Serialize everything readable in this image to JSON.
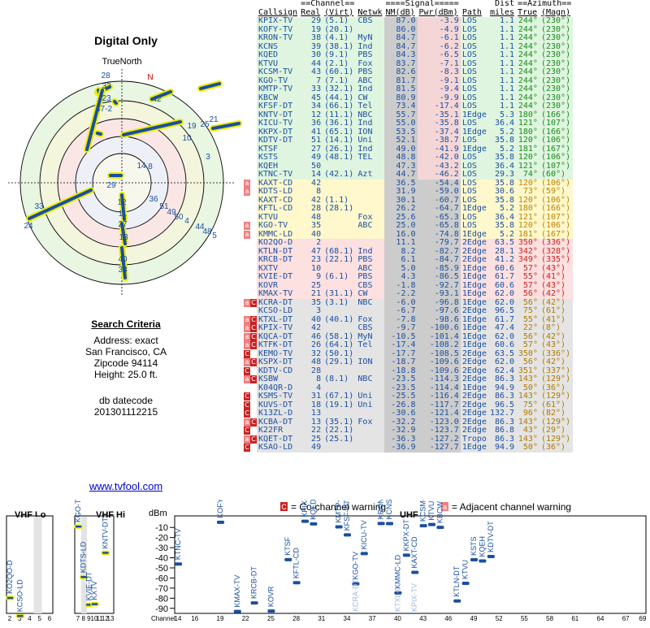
{
  "title": "Digital Only",
  "polar": {
    "north_label": "TrueNorth",
    "n_label": "N"
  },
  "criteria": {
    "heading": "Search Criteria",
    "address": "Address: exact",
    "city": "San Francisco, CA",
    "zip": "Zipcode 94114",
    "height": "Height: 25.0 ft.",
    "db_label": "db datecode",
    "db_value": "201301112215"
  },
  "link": "www.tvfool.com",
  "table_headers": {
    "group1": "==Channel==",
    "group2": "====Signal=====",
    "group3": "Dist",
    "group4": "==Azimuth==",
    "callsign": "Callsign",
    "real": "Real",
    "virt": "(Virt)",
    "netwk": "Netwk",
    "nm": "NM(dB)",
    "pwr": "Pwr(dBm)",
    "path": "Path",
    "miles": "miles",
    "true": "True",
    "magn": "(Magn)"
  },
  "colors": {
    "green": "#dff5df",
    "yellow": "#fff8cc",
    "red": "#fde0e0",
    "gray": "#e4e4e4",
    "accent_blue": "#1a4fa0"
  },
  "stations": [
    {
      "cs": "KPIX-TV",
      "real": "29",
      "virt": "(5.1)",
      "net": "CBS",
      "nm": "87.0",
      "pwr": "-3.9",
      "path": "LOS",
      "dist": "1.1",
      "t": "244°",
      "m": "(230°)",
      "band": "green",
      "warn": ""
    },
    {
      "cs": "KOFY-TV",
      "real": "19",
      "virt": "(20.1)",
      "net": "",
      "nm": "86.0",
      "pwr": "-4.9",
      "path": "LOS",
      "dist": "1.1",
      "t": "244°",
      "m": "(230°)",
      "band": "green",
      "warn": ""
    },
    {
      "cs": "KRON-TV",
      "real": "38",
      "virt": "(4.1)",
      "net": "MyN",
      "nm": "84.7",
      "pwr": "-6.1",
      "path": "LOS",
      "dist": "1.1",
      "t": "244°",
      "m": "(230°)",
      "band": "green",
      "warn": ""
    },
    {
      "cs": "KCNS",
      "real": "39",
      "virt": "(38.1)",
      "net": "Ind",
      "nm": "84.7",
      "pwr": "-6.2",
      "path": "LOS",
      "dist": "1.1",
      "t": "244°",
      "m": "(230°)",
      "band": "green",
      "warn": ""
    },
    {
      "cs": "KQED",
      "real": "30",
      "virt": "(9.1)",
      "net": "PBS",
      "nm": "84.3",
      "pwr": "-6.5",
      "path": "LOS",
      "dist": "1.1",
      "t": "244°",
      "m": "(230°)",
      "band": "green",
      "warn": ""
    },
    {
      "cs": "KTVU",
      "real": "44",
      "virt": "(2.1)",
      "net": "Fox",
      "nm": "83.7",
      "pwr": "-7.1",
      "path": "LOS",
      "dist": "1.1",
      "t": "244°",
      "m": "(230°)",
      "band": "green",
      "warn": ""
    },
    {
      "cs": "KCSM-TV",
      "real": "43",
      "virt": "(60.1)",
      "net": "PBS",
      "nm": "82.6",
      "pwr": "-8.3",
      "path": "LOS",
      "dist": "1.1",
      "t": "244°",
      "m": "(230°)",
      "band": "green",
      "warn": ""
    },
    {
      "cs": "KGO-TV",
      "real": "7",
      "virt": "(7.1)",
      "net": "ABC",
      "nm": "81.7",
      "pwr": "-9.1",
      "path": "LOS",
      "dist": "1.1",
      "t": "244°",
      "m": "(230°)",
      "band": "green",
      "warn": ""
    },
    {
      "cs": "KMTP-TV",
      "real": "33",
      "virt": "(32.1)",
      "net": "Ind",
      "nm": "81.5",
      "pwr": "-9.4",
      "path": "LOS",
      "dist": "1.1",
      "t": "244°",
      "m": "(230°)",
      "band": "green",
      "warn": ""
    },
    {
      "cs": "KBCW",
      "real": "45",
      "virt": "(44.1)",
      "net": "CW",
      "nm": "80.9",
      "pwr": "-9.9",
      "path": "LOS",
      "dist": "1.1",
      "t": "244°",
      "m": "(230°)",
      "band": "green",
      "warn": ""
    },
    {
      "cs": "KFSF-DT",
      "real": "34",
      "virt": "(66.1)",
      "net": "Tel",
      "nm": "73.4",
      "pwr": "-17.4",
      "path": "LOS",
      "dist": "1.1",
      "t": "244°",
      "m": "(230°)",
      "band": "green",
      "warn": ""
    },
    {
      "cs": "KNTV-DT",
      "real": "12",
      "virt": "(11.1)",
      "net": "NBC",
      "nm": "55.7",
      "pwr": "-35.1",
      "path": "1Edge",
      "dist": "5.3",
      "t": "180°",
      "m": "(166°)",
      "band": "green",
      "warn": ""
    },
    {
      "cs": "KICU-TV",
      "real": "36",
      "virt": "(36.1)",
      "net": "Ind",
      "nm": "55.0",
      "pwr": "-35.8",
      "path": "LOS",
      "dist": "36.4",
      "t": "121°",
      "m": "(107°)",
      "band": "green",
      "warn": ""
    },
    {
      "cs": "KKPX-DT",
      "real": "41",
      "virt": "(65.1)",
      "net": "ION",
      "nm": "53.5",
      "pwr": "-37.4",
      "path": "1Edge",
      "dist": "5.2",
      "t": "180°",
      "m": "(166°)",
      "band": "green",
      "warn": ""
    },
    {
      "cs": "KDTV-DT",
      "real": "51",
      "virt": "(14.1)",
      "net": "Uni",
      "nm": "52.1",
      "pwr": "-38.7",
      "path": "LOS",
      "dist": "35.8",
      "t": "120°",
      "m": "(106°)",
      "band": "green",
      "warn": ""
    },
    {
      "cs": "KTSF",
      "real": "27",
      "virt": "(26.1)",
      "net": "Ind",
      "nm": "49.0",
      "pwr": "-41.9",
      "path": "1Edge",
      "dist": "5.2",
      "t": "181°",
      "m": "(167°)",
      "band": "green",
      "warn": ""
    },
    {
      "cs": "KSTS",
      "real": "49",
      "virt": "(48.1)",
      "net": "TEL",
      "nm": "48.8",
      "pwr": "-42.0",
      "path": "LOS",
      "dist": "35.8",
      "t": "120°",
      "m": "(106°)",
      "band": "green",
      "warn": ""
    },
    {
      "cs": "KQEH",
      "real": "50",
      "virt": "",
      "net": "",
      "nm": "47.3",
      "pwr": "-43.2",
      "path": "LOS",
      "dist": "36.4",
      "t": "121°",
      "m": "(107°)",
      "band": "green",
      "warn": ""
    },
    {
      "cs": "KTNC-TV",
      "real": "14",
      "virt": "(42.1)",
      "net": "Azt",
      "nm": "44.7",
      "pwr": "-46.2",
      "path": "LOS",
      "dist": "29.3",
      "t": "74°",
      "m": "(60°)",
      "band": "green",
      "warn": ""
    },
    {
      "cs": "KAXT-CD",
      "real": "42",
      "virt": "",
      "net": "",
      "nm": "36.5",
      "pwr": "-54.4",
      "path": "LOS",
      "dist": "35.8",
      "t": "120°",
      "m": "(106°)",
      "band": "yellow",
      "warn": "a"
    },
    {
      "cs": "KDTS-LD",
      "real": "8",
      "virt": "",
      "net": "",
      "nm": "31.9",
      "pwr": "-59.0",
      "path": "LOS",
      "dist": "30.6",
      "t": "73°",
      "m": "(59°)",
      "band": "yellow",
      "warn": "a"
    },
    {
      "cs": "KAXT-CD",
      "real": "42",
      "virt": "(1.1)",
      "net": "",
      "nm": "30.1",
      "pwr": "-60.7",
      "path": "LOS",
      "dist": "35.8",
      "t": "120°",
      "m": "(106°)",
      "band": "yellow",
      "warn": ""
    },
    {
      "cs": "KFTL-CD",
      "real": "28",
      "virt": "(28.1)",
      "net": "",
      "nm": "26.2",
      "pwr": "-64.7",
      "path": "1Edge",
      "dist": "5.2",
      "t": "180°",
      "m": "(166°)",
      "band": "yellow",
      "warn": ""
    },
    {
      "cs": "KTVU",
      "real": "48",
      "virt": "",
      "net": "Fox",
      "nm": "25.6",
      "pwr": "-65.3",
      "path": "LOS",
      "dist": "36.4",
      "t": "121°",
      "m": "(107°)",
      "band": "yellow",
      "warn": ""
    },
    {
      "cs": "KGO-TV",
      "real": "35",
      "virt": "",
      "net": "ABC",
      "nm": "25.0",
      "pwr": "-65.8",
      "path": "LOS",
      "dist": "35.8",
      "t": "120°",
      "m": "(106°)",
      "band": "yellow",
      "warn": "a"
    },
    {
      "cs": "KMMC-LD",
      "real": "40",
      "virt": "",
      "net": "",
      "nm": "16.0",
      "pwr": "-74.8",
      "path": "1Edge",
      "dist": "5.2",
      "t": "181°",
      "m": "(167°)",
      "band": "yellow",
      "warn": "a"
    },
    {
      "cs": "KO2QO-D",
      "real": "2",
      "virt": "",
      "net": "",
      "nm": "11.1",
      "pwr": "-79.7",
      "path": "2Edge",
      "dist": "63.5",
      "t": "350°",
      "m": "(336°)",
      "band": "red",
      "warn": ""
    },
    {
      "cs": "KTLN-DT",
      "real": "47",
      "virt": "(68.1)",
      "net": "Ind",
      "nm": "8.2",
      "pwr": "-82.7",
      "path": "2Edge",
      "dist": "28.1",
      "t": "342°",
      "m": "(328°)",
      "band": "red",
      "warn": ""
    },
    {
      "cs": "KRCB-DT",
      "real": "23",
      "virt": "(22.1)",
      "net": "PBS",
      "nm": "6.1",
      "pwr": "-84.7",
      "path": "2Edge",
      "dist": "41.2",
      "t": "349°",
      "m": "(335°)",
      "band": "red",
      "warn": ""
    },
    {
      "cs": "KXTV",
      "real": "10",
      "virt": "",
      "net": "ABC",
      "nm": "5.0",
      "pwr": "-85.9",
      "path": "1Edge",
      "dist": "60.6",
      "t": "57°",
      "m": "(43°)",
      "band": "red",
      "warn": ""
    },
    {
      "cs": "KVIE-DT",
      "real": "9",
      "virt": "(6.1)",
      "net": "PBS",
      "nm": "4.3",
      "pwr": "-86.5",
      "path": "1Edge",
      "dist": "61.7",
      "t": "55°",
      "m": "(41°)",
      "band": "red",
      "warn": ""
    },
    {
      "cs": "KOVR",
      "real": "25",
      "virt": "",
      "net": "CBS",
      "nm": "-1.8",
      "pwr": "-92.7",
      "path": "1Edge",
      "dist": "60.6",
      "t": "57°",
      "m": "(43°)",
      "band": "red",
      "warn": ""
    },
    {
      "cs": "KMAX-TV",
      "real": "21",
      "virt": "(31.1)",
      "net": "CW",
      "nm": "-2.2",
      "pwr": "-93.1",
      "path": "1Edge",
      "dist": "62.0",
      "t": "56°",
      "m": "(42°)",
      "band": "red",
      "warn": ""
    },
    {
      "cs": "KCRA-DT",
      "real": "35",
      "virt": "(3.1)",
      "net": "NBC",
      "nm": "-6.0",
      "pwr": "-96.8",
      "path": "1Edge",
      "dist": "62.0",
      "t": "56°",
      "m": "(42°)",
      "band": "gray",
      "warn": "ac"
    },
    {
      "cs": "KCSO-LD",
      "real": "3",
      "virt": "",
      "net": "",
      "nm": "-6.7",
      "pwr": "-97.6",
      "path": "2Edge",
      "dist": "96.5",
      "t": "75°",
      "m": "(61°)",
      "band": "gray",
      "warn": ""
    },
    {
      "cs": "KTXL-DT",
      "real": "40",
      "virt": "(40.1)",
      "net": "Fox",
      "nm": "-7.8",
      "pwr": "-98.6",
      "path": "1Edge",
      "dist": "61.7",
      "t": "55°",
      "m": "(41°)",
      "band": "gray",
      "warn": "ac"
    },
    {
      "cs": "KPIX-TV",
      "real": "42",
      "virt": "",
      "net": "CBS",
      "nm": "-9.7",
      "pwr": "-100.6",
      "path": "1Edge",
      "dist": "47.4",
      "t": "22°",
      "m": "(8°)",
      "band": "gray",
      "warn": "ac"
    },
    {
      "cs": "KQCA-DT",
      "real": "46",
      "virt": "(58.1)",
      "net": "MyN",
      "nm": "-10.5",
      "pwr": "-101.4",
      "path": "1Edge",
      "dist": "62.0",
      "t": "56°",
      "m": "(42°)",
      "band": "gray",
      "warn": "ac"
    },
    {
      "cs": "KTFK-DT",
      "real": "26",
      "virt": "(64.1)",
      "net": "Tel",
      "nm": "-17.4",
      "pwr": "-108.2",
      "path": "1Edge",
      "dist": "60.6",
      "t": "57°",
      "m": "(43°)",
      "band": "gray",
      "warn": "ac"
    },
    {
      "cs": "KEMO-TV",
      "real": "32",
      "virt": "(50.1)",
      "net": "",
      "nm": "-17.7",
      "pwr": "-108.5",
      "path": "2Edge",
      "dist": "63.5",
      "t": "350°",
      "m": "(336°)",
      "band": "gray",
      "warn": "c"
    },
    {
      "cs": "KSPX-DT",
      "real": "48",
      "virt": "(29.1)",
      "net": "ION",
      "nm": "-18.7",
      "pwr": "-109.6",
      "path": "2Edge",
      "dist": "62.0",
      "t": "56°",
      "m": "(42°)",
      "band": "gray",
      "warn": "ac"
    },
    {
      "cs": "KDTV-CD",
      "real": "28",
      "virt": "",
      "net": "",
      "nm": "-18.8",
      "pwr": "-109.6",
      "path": "2Edge",
      "dist": "62.4",
      "t": "351°",
      "m": "(337°)",
      "band": "gray",
      "warn": "c"
    },
    {
      "cs": "KSBW",
      "real": "8",
      "virt": "(8.1)",
      "net": "NBC",
      "nm": "-23.5",
      "pwr": "-114.3",
      "path": "2Edge",
      "dist": "86.3",
      "t": "143°",
      "m": "(129°)",
      "band": "gray",
      "warn": "ac"
    },
    {
      "cs": "K04QR-D",
      "real": "4",
      "virt": "",
      "net": "",
      "nm": "-23.5",
      "pwr": "-114.4",
      "path": "1Edge",
      "dist": "94.9",
      "t": "50°",
      "m": "(36°)",
      "band": "gray",
      "warn": ""
    },
    {
      "cs": "KSMS-TV",
      "real": "31",
      "virt": "(67.1)",
      "net": "Uni",
      "nm": "-25.5",
      "pwr": "-116.4",
      "path": "2Edge",
      "dist": "86.3",
      "t": "143°",
      "m": "(129°)",
      "band": "gray",
      "warn": "c"
    },
    {
      "cs": "KUVS-DT",
      "real": "18",
      "virt": "(19.1)",
      "net": "Uni",
      "nm": "-26.8",
      "pwr": "-117.7",
      "path": "2Edge",
      "dist": "96.5",
      "t": "75°",
      "m": "(61°)",
      "band": "gray",
      "warn": "c"
    },
    {
      "cs": "K13ZL-D",
      "real": "13",
      "virt": "",
      "net": "",
      "nm": "-30.6",
      "pwr": "-121.4",
      "path": "2Edge",
      "dist": "132.7",
      "t": "96°",
      "m": "(82°)",
      "band": "gray",
      "warn": "c"
    },
    {
      "cs": "KCBA-DT",
      "real": "13",
      "virt": "(35.1)",
      "net": "Fox",
      "nm": "-32.2",
      "pwr": "-123.0",
      "path": "2Edge",
      "dist": "86.3",
      "t": "143°",
      "m": "(129°)",
      "band": "gray",
      "warn": "ac"
    },
    {
      "cs": "K22FR",
      "real": "22",
      "virt": "(22.1)",
      "net": "",
      "nm": "-32.9",
      "pwr": "-123.7",
      "path": "2Edge",
      "dist": "86.8",
      "t": "43°",
      "m": "(29°)",
      "band": "gray",
      "warn": "c"
    },
    {
      "cs": "KQET-DT",
      "real": "25",
      "virt": "(25.1)",
      "net": "",
      "nm": "-36.3",
      "pwr": "-127.2",
      "path": "Tropo",
      "dist": "86.3",
      "t": "143°",
      "m": "(129°)",
      "band": "gray",
      "warn": "ac"
    },
    {
      "cs": "KSAO-LD",
      "real": "49",
      "virt": "",
      "net": "",
      "nm": "-36.9",
      "pwr": "-127.7",
      "path": "1Edge",
      "dist": "94.9",
      "t": "50°",
      "m": "(36°)",
      "band": "gray",
      "warn": "c"
    }
  ],
  "legend": {
    "co_channel": "= Co-channel warning",
    "adjacent": "= Adjacent channel warning",
    "co_glyph": "C",
    "adj_glyph": "a"
  },
  "chart_data": {
    "type": "scatter",
    "title": "",
    "ylabel": "dBm",
    "xlabel": "Channel",
    "ylim": [
      -95,
      -5
    ],
    "yticks": [
      -10,
      -20,
      -30,
      -40,
      -50,
      -60,
      -70,
      -80,
      -90
    ],
    "panels": [
      {
        "label": "VHF Lo",
        "channels": [
          2,
          3,
          4,
          5,
          6
        ]
      },
      {
        "label": "VHF Hi",
        "channels": [
          7,
          8,
          9,
          10,
          11,
          12,
          13
        ]
      },
      {
        "label": "UHF",
        "channels": [
          14,
          16,
          19,
          22,
          25,
          28,
          31,
          34,
          37,
          40,
          43,
          46,
          49,
          52,
          55,
          58,
          61,
          64,
          67,
          69
        ]
      }
    ],
    "points": [
      {
        "cs": "KO2QO-D",
        "ch": 2,
        "pwr": -79.7
      },
      {
        "cs": "KCSO-LD",
        "ch": 3,
        "pwr": -97.6
      },
      {
        "cs": "KGO-TV",
        "ch": 7,
        "pwr": -9.1
      },
      {
        "cs": "KDTS-LD",
        "ch": 8,
        "pwr": -59.0
      },
      {
        "cs": "KVIE-DT",
        "ch": 9,
        "pwr": -86.5
      },
      {
        "cs": "KXTV",
        "ch": 10,
        "pwr": -85.9
      },
      {
        "cs": "KNTV-DT",
        "ch": 12,
        "pwr": -35.1
      },
      {
        "cs": "KTNC-TV",
        "ch": 14,
        "pwr": -46.2
      },
      {
        "cs": "KOFY-TV",
        "ch": 19,
        "pwr": -4.9
      },
      {
        "cs": "KMAX-TV",
        "ch": 21,
        "pwr": -93.1
      },
      {
        "cs": "KRCB-DT",
        "ch": 23,
        "pwr": -84.7
      },
      {
        "cs": "KOVR",
        "ch": 25,
        "pwr": -92.7
      },
      {
        "cs": "KTSF",
        "ch": 27,
        "pwr": -41.9
      },
      {
        "cs": "KFTL-CD",
        "ch": 28,
        "pwr": -64.7
      },
      {
        "cs": "KPIX-TV",
        "ch": 29,
        "pwr": -3.9
      },
      {
        "cs": "KQED",
        "ch": 30,
        "pwr": -6.5
      },
      {
        "cs": "KMTP-TV",
        "ch": 33,
        "pwr": -9.4
      },
      {
        "cs": "KFSF-DT",
        "ch": 34,
        "pwr": -17.4
      },
      {
        "cs": "KGO-TV",
        "ch": 35,
        "pwr": -65.8
      },
      {
        "cs": "KICU-TV",
        "ch": 36,
        "pwr": -35.8
      },
      {
        "cs": "KRON-TV",
        "ch": 38,
        "pwr": -6.1
      },
      {
        "cs": "KCNS",
        "ch": 39,
        "pwr": -6.2
      },
      {
        "cs": "KMMC-LD",
        "ch": 40,
        "pwr": -74.8
      },
      {
        "cs": "KKPX-DT",
        "ch": 41,
        "pwr": -37.4
      },
      {
        "cs": "KAXT-CD",
        "ch": 42,
        "pwr": -54.4
      },
      {
        "cs": "KCSM-TV",
        "ch": 43,
        "pwr": -8.3
      },
      {
        "cs": "KTVU",
        "ch": 44,
        "pwr": -7.1
      },
      {
        "cs": "KBCW",
        "ch": 45,
        "pwr": -9.9
      },
      {
        "cs": "KTLN-DT",
        "ch": 47,
        "pwr": -82.7
      },
      {
        "cs": "KTVU",
        "ch": 48,
        "pwr": -65.3
      },
      {
        "cs": "KSTS",
        "ch": 49,
        "pwr": -42.0
      },
      {
        "cs": "KQEH",
        "ch": 50,
        "pwr": -43.2
      },
      {
        "cs": "KDTV-DT",
        "ch": 51,
        "pwr": -38.7
      }
    ],
    "faint_labels": [
      {
        "cs": "KCRA-DT",
        "ch": 35
      },
      {
        "cs": "KTXL-DT",
        "ch": 40
      },
      {
        "cs": "KPIX-TV",
        "ch": 42
      }
    ]
  },
  "polar_data": {
    "ring_labels": [
      "28",
      "32",
      "23",
      "47-2",
      "42",
      "21",
      "25",
      "19",
      "10",
      "3",
      "14",
      "8",
      "29",
      "12",
      "11",
      "27",
      "13",
      "40",
      "38",
      "36",
      "51",
      "49",
      "50",
      "4",
      "44",
      "48",
      "5",
      "33",
      "24"
    ]
  }
}
